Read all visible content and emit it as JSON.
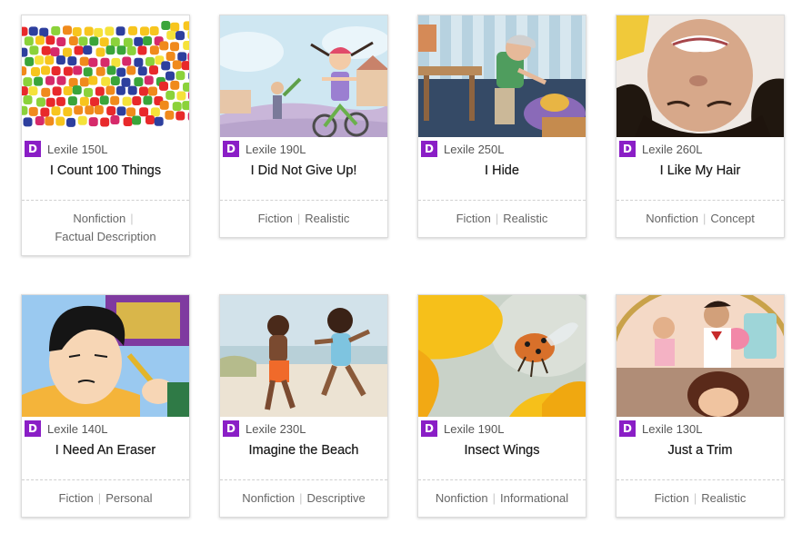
{
  "badge_color": "#8a1ec6",
  "books": [
    {
      "level": "D",
      "lexile": "Lexile 150L",
      "title": "I Count 100 Things",
      "genre1": "Nonfiction",
      "genre2": "Factual Description",
      "cover": "colorful candy pile"
    },
    {
      "level": "D",
      "lexile": "Lexile 190L",
      "title": "I Did Not Give Up!",
      "genre1": "Fiction",
      "genre2": "Realistic",
      "cover": "girl riding bicycle illustration"
    },
    {
      "level": "D",
      "lexile": "Lexile 250L",
      "title": "I Hide",
      "genre1": "Fiction",
      "genre2": "Realistic",
      "cover": "grandmother and hiding child illustration"
    },
    {
      "level": "D",
      "lexile": "Lexile 260L",
      "title": "I Like My Hair",
      "genre1": "Nonfiction",
      "genre2": "Concept",
      "cover": "upside-down smiling girl photo"
    },
    {
      "level": "D",
      "lexile": "Lexile 140L",
      "title": "I Need An Eraser",
      "genre1": "Fiction",
      "genre2": "Personal",
      "cover": "boy with pencil illustration"
    },
    {
      "level": "D",
      "lexile": "Lexile 230L",
      "title": "Imagine the Beach",
      "genre1": "Nonfiction",
      "genre2": "Descriptive",
      "cover": "children running on beach photo"
    },
    {
      "level": "D",
      "lexile": "Lexile 190L",
      "title": "Insect Wings",
      "genre1": "Nonfiction",
      "genre2": "Informational",
      "cover": "ladybug flying near flower photo"
    },
    {
      "level": "D",
      "lexile": "Lexile 130L",
      "title": "Just a Trim",
      "genre1": "Fiction",
      "genre2": "Realistic",
      "cover": "barber shop illustration"
    }
  ]
}
